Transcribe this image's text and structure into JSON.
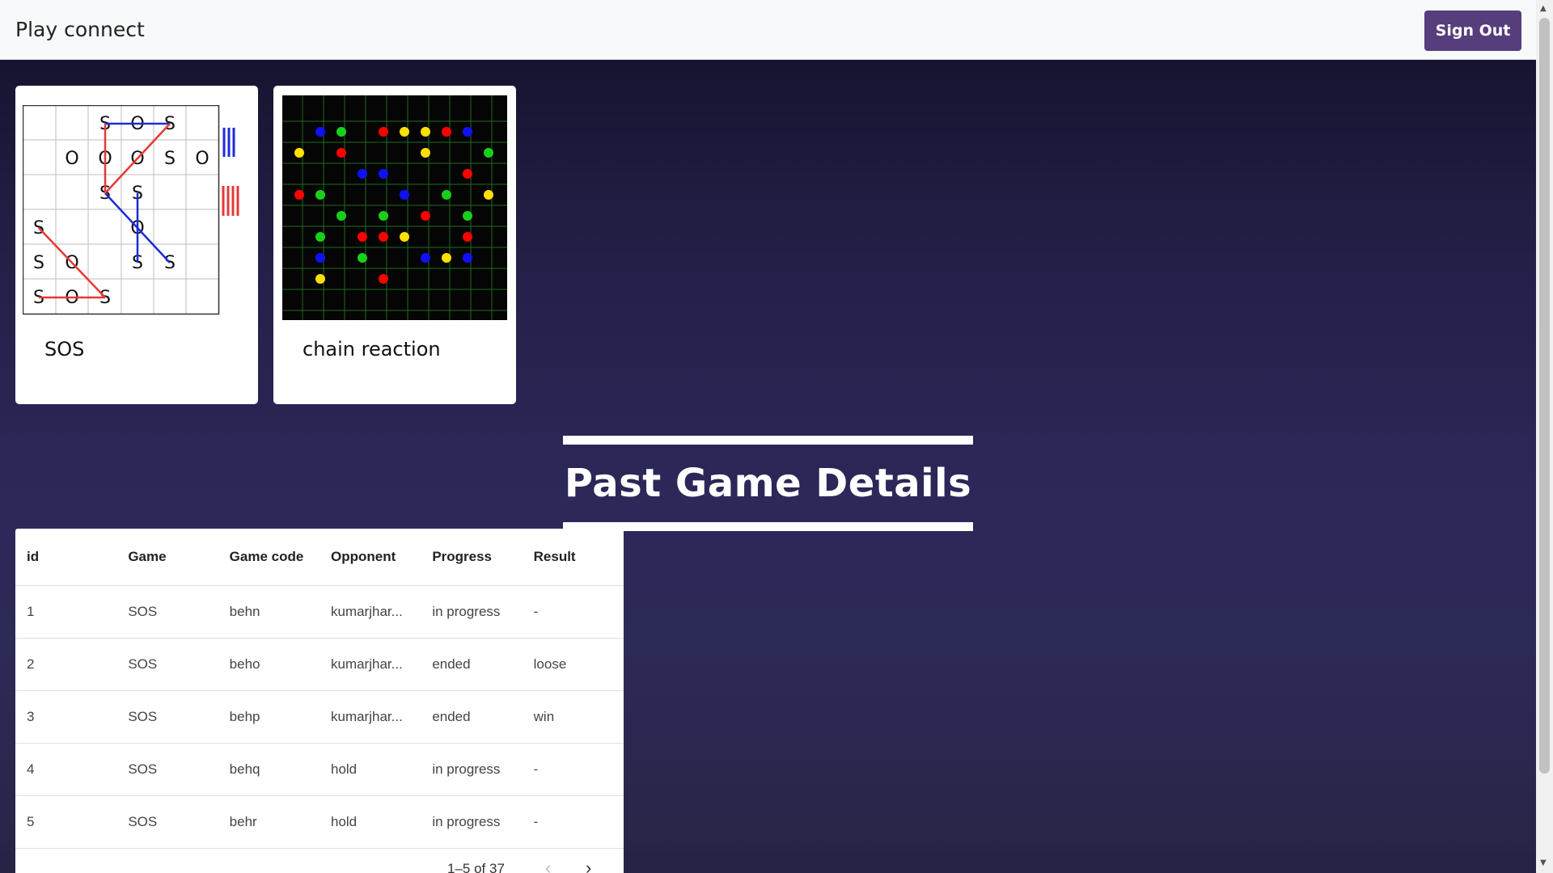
{
  "navbar": {
    "brand": "Play connect",
    "signout_label": "Sign Out"
  },
  "games": [
    {
      "title": "SOS",
      "image": "sos-board"
    },
    {
      "title": "chain reaction",
      "image": "chain-reaction-board"
    }
  ],
  "section_title": "Past Game Details",
  "table": {
    "columns": [
      "id",
      "Game",
      "Game code",
      "Opponent",
      "Progress",
      "Result"
    ],
    "rows": [
      [
        "1",
        "SOS",
        "behn",
        "kumarjhar...",
        "in progress",
        "-"
      ],
      [
        "2",
        "SOS",
        "beho",
        "kumarjhar...",
        "ended",
        "loose"
      ],
      [
        "3",
        "SOS",
        "behp",
        "kumarjhar...",
        "ended",
        "win"
      ],
      [
        "4",
        "SOS",
        "behq",
        "hold",
        "in progress",
        "-"
      ],
      [
        "5",
        "SOS",
        "behr",
        "hold",
        "in progress",
        "-"
      ]
    ],
    "pagination": {
      "range": "1–5 of 37"
    }
  },
  "colors": {
    "brand_button": "#563d7c",
    "sos_red": "#e53935",
    "sos_blue": "#1e2bd8"
  },
  "icons": {
    "prev": "chevron-left-icon",
    "next": "chevron-right-icon"
  }
}
